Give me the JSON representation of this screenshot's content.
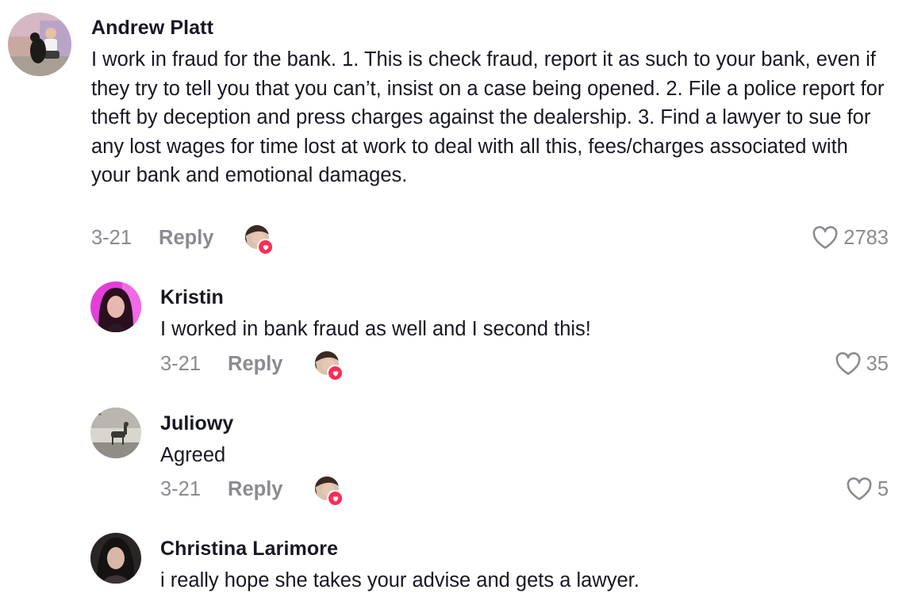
{
  "comments": [
    {
      "username": "Andrew Platt",
      "text": "I work in fraud for the bank. 1. This is check fraud, report it as such to your bank, even if they try to tell you that you can’t, insist on a case being opened. 2. File a police report for theft by deception and press charges against the dealership. 3. Find a lawyer to sue for any lost wages for time lost at work to deal with all this, fees/charges associated with your bank and emotional damages.",
      "date": "3-21",
      "reply_label": "Reply",
      "likes": "2783",
      "creator_liked": true
    },
    {
      "username": "Kristin",
      "text": "I worked in bank fraud as well and I second this!",
      "date": "3-21",
      "reply_label": "Reply",
      "likes": "35",
      "creator_liked": true
    },
    {
      "username": "Juliowy",
      "text": "Agreed",
      "date": "3-21",
      "reply_label": "Reply",
      "likes": "5",
      "creator_liked": true
    },
    {
      "username": "Christina Larimore",
      "text": "i really hope she takes your advise and gets a lawyer."
    }
  ],
  "colors": {
    "text_primary": "#161823",
    "text_secondary": "#8a8b91",
    "creator_heart": "#fe2c55",
    "background": "#ffffff"
  },
  "icons": {
    "like": "heart-outline-icon",
    "creator_like_badge": "heart-filled-icon"
  }
}
